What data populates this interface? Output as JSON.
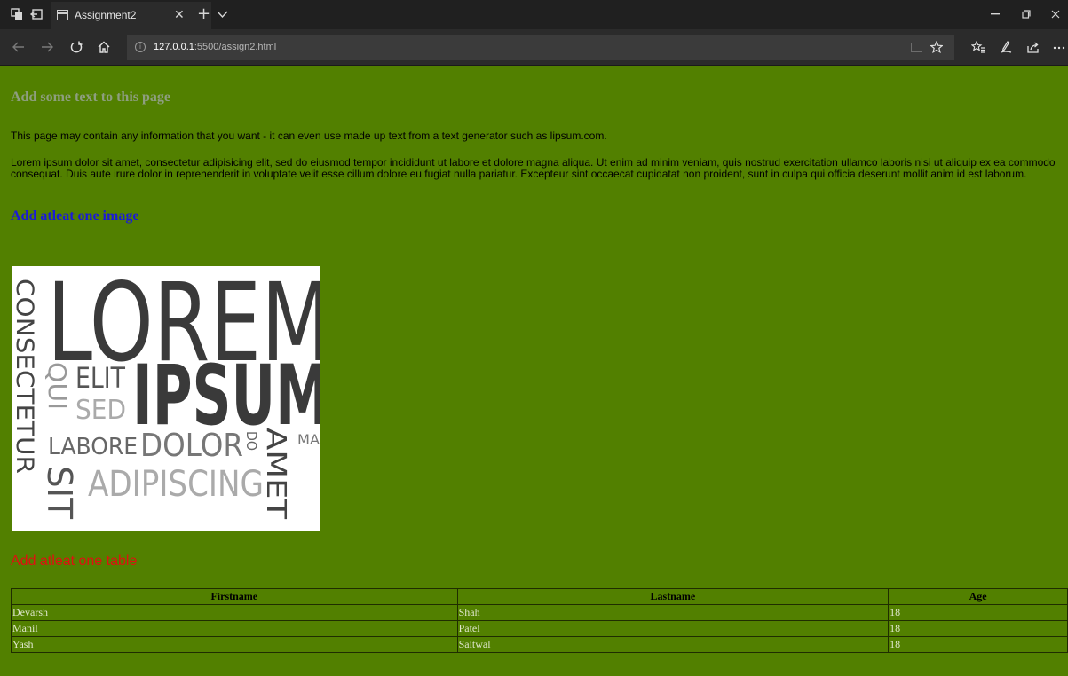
{
  "browser": {
    "tab_title": "Assignment2",
    "new_tab_symbol": "+",
    "close_symbol": "✕",
    "url_host": "127.0.0.1",
    "url_path": ":5500/assign2.html"
  },
  "icons": [
    "tab-actions-icon",
    "set-aside-tabs-icon",
    "page-icon",
    "tab-close-icon",
    "new-tab-icon",
    "tab-list-icon",
    "minimize-icon",
    "maximize-icon",
    "window-close-icon",
    "back-icon",
    "forward-icon",
    "refresh-icon",
    "home-icon",
    "site-info-icon",
    "reading-view-icon",
    "favorite-star-icon",
    "favorites-list-icon",
    "notes-pen-icon",
    "share-icon",
    "more-icon"
  ],
  "page": {
    "heading_gray": "Add some text to this page",
    "paragraph1": "This page may contain any information that you want - it can even use made up text from a text generator such as lipsum.com.",
    "paragraph2": "Lorem ipsum dolor sit amet, consectetur adipisicing elit, sed do eiusmod tempor incididunt ut labore et dolore magna aliqua. Ut enim ad minim veniam, quis nostrud exercitation ullamco laboris nisi ut aliquip ex ea commodo consequat. Duis aute irure dolor in reprehenderit in voluptate velit esse cillum dolore eu fugiat nulla pariatur. Excepteur sint occaecat cupidatat non proident, sunt in culpa qui officia deserunt mollit anim id est laborum.",
    "heading_blue": "Add atleat one image",
    "heading_red": "Add atleat one table"
  },
  "image_words": {
    "lorem": "LOREM",
    "ipsum": "IPSUM",
    "consectetur": "CONSECTETUR",
    "elit": "ELIT",
    "qui": "QUI",
    "sed": "SED",
    "labore": "LABORE",
    "dolor": "DOLOR",
    "do": "DO",
    "amet": "AMET",
    "ma": "MA",
    "sit": "SIT",
    "adipiscing": "ADIPISCING"
  },
  "table": {
    "headers": [
      "Firstname",
      "Lastname",
      "Age"
    ],
    "rows": [
      [
        "Devarsh",
        "Shah",
        "18"
      ],
      [
        "Manil",
        "Patel",
        "18"
      ],
      [
        "Yash",
        "Saitwal",
        "18"
      ]
    ]
  }
}
